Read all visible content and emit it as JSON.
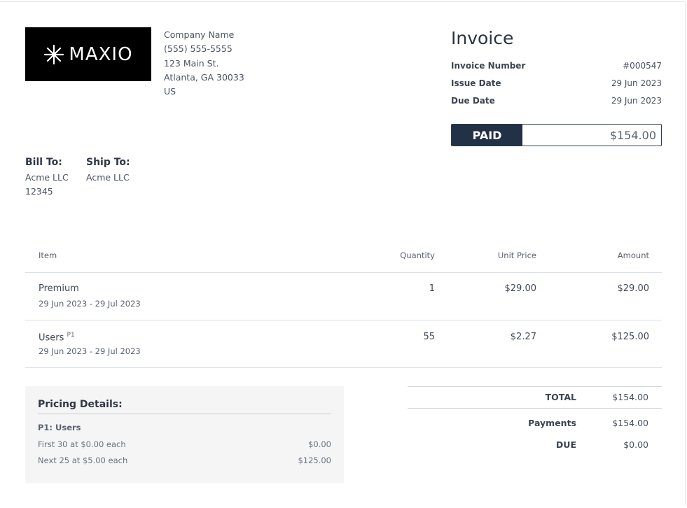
{
  "logo": {
    "text": "MAXIO"
  },
  "company": {
    "name": "Company Name",
    "phone": "(555) 555-5555",
    "street": "123 Main St.",
    "city": "Atlanta, GA 30033",
    "country": "US"
  },
  "invoice": {
    "title": "Invoice",
    "number_label": "Invoice Number",
    "number": "#000547",
    "issue_label": "Issue Date",
    "issue_date": "29 Jun 2023",
    "due_label": "Due Date",
    "due_date": "29 Jun 2023",
    "status": "PAID",
    "status_amount": "$154.00"
  },
  "bill_to": {
    "label": "Bill To:",
    "line1": "Acme LLC",
    "line2": "12345"
  },
  "ship_to": {
    "label": "Ship To:",
    "line1": "Acme LLC"
  },
  "table": {
    "headers": {
      "item": "Item",
      "quantity": "Quantity",
      "unit_price": "Unit Price",
      "amount": "Amount"
    },
    "rows": [
      {
        "item": "Premium",
        "marker": "",
        "period": "29 Jun 2023 - 29 Jul 2023",
        "quantity": "1",
        "unit_price": "$29.00",
        "amount": "$29.00"
      },
      {
        "item": "Users",
        "marker": "P1",
        "period": "29 Jun 2023 - 29 Jul 2023",
        "quantity": "55",
        "unit_price": "$2.27",
        "amount": "$125.00"
      }
    ]
  },
  "pricing": {
    "title": "Pricing Details:",
    "subtitle": "P1: Users",
    "tiers": [
      {
        "label": "First 30 at $0.00 each",
        "amount": "$0.00"
      },
      {
        "label": "Next 25 at $5.00 each",
        "amount": "$125.00"
      }
    ]
  },
  "totals": {
    "total_label": "TOTAL",
    "total": "$154.00",
    "payments_label": "Payments",
    "payments": "$154.00",
    "due_label": "DUE",
    "due": "$0.00"
  }
}
